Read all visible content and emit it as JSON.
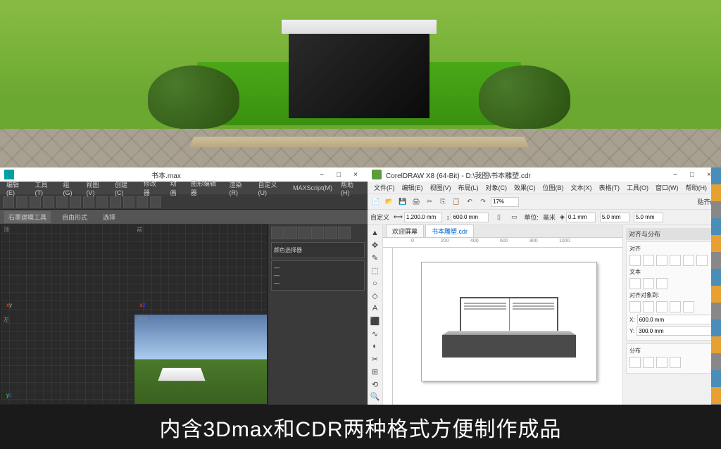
{
  "caption": "内含3Dmax和CDR两种格式方便制作成品",
  "max": {
    "title": "书本.max",
    "menus": [
      "编辑(E)",
      "工具(T)",
      "组(G)",
      "视图(V)",
      "创建(C)",
      "修改器",
      "动画",
      "图形编辑器",
      "渲染(R)",
      "自定义(U)",
      "MAXScript(M)",
      "帮助(H)"
    ],
    "ribbon_tabs": [
      "石墨建模工具",
      "自由形式",
      "选择"
    ],
    "viewports": [
      "顶",
      "前",
      "左",
      "透视"
    ],
    "side_section": "颜色选择器"
  },
  "cdr": {
    "title": "CorelDRAW X8 (64-Bit) - D:\\我图\\书本雕塑.cdr",
    "menus": [
      "文件(F)",
      "编辑(E)",
      "视图(V)",
      "布局(L)",
      "对象(C)",
      "效果(C)",
      "位图(B)",
      "文本(X)",
      "表格(T)",
      "工具(O)",
      "窗口(W)",
      "帮助(H)"
    ],
    "preset_label": "自定义",
    "page_w": "1,200.0 mm",
    "page_h": "600.0 mm",
    "zoom": "17%",
    "units_label": "单位:",
    "units": "毫米",
    "nudge": "0.1 mm",
    "dup_x": "5.0 mm",
    "dup_y": "5.0 mm",
    "snap_label": "贴齐(T)",
    "tabs": [
      {
        "label": "欢迎屏幕",
        "active": false
      },
      {
        "label": "书本雕塑.cdr",
        "active": true
      }
    ],
    "ruler_marks": [
      "0",
      "200",
      "400",
      "600",
      "800",
      "1000"
    ],
    "tools": [
      "▲",
      "✥",
      "✎",
      "⬚",
      "○",
      "◇",
      "A",
      "⬛",
      "∿",
      "◐",
      "✂",
      "⊞",
      "⟲",
      "🔍"
    ],
    "docker_title": "对齐与分布",
    "docker_sections": {
      "header1": "对齐",
      "header2": "文本",
      "header3": "对齐对象到:",
      "x_label": "X:",
      "y_label": "Y:",
      "x_val": "600.0 mm",
      "y_val": "300.0 mm",
      "dist_header": "分布"
    }
  }
}
